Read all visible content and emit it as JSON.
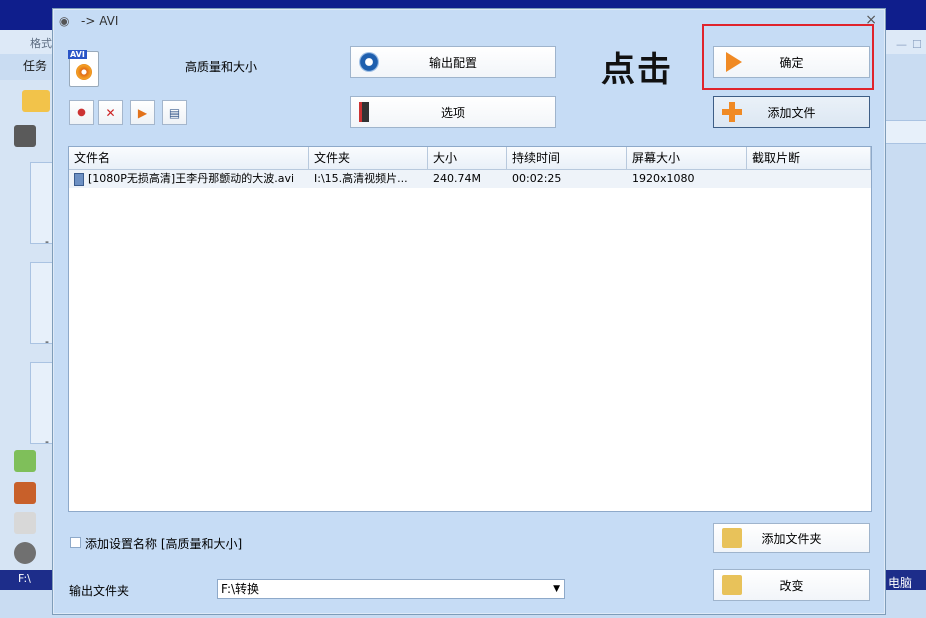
{
  "background": {
    "title": "格式",
    "tasks_label": "任务",
    "drive_label": "F:\\",
    "pc_label": "电脑",
    "dash": "-"
  },
  "dialog": {
    "title": "-> AVI",
    "close": "×",
    "profile_label": "高质量和大小",
    "profile_icon_tag": "AVI",
    "output_config_button": "输出配置",
    "options_button": "选项",
    "ok_button": "确定",
    "add_file_button": "添加文件",
    "add_folder_button": "添加文件夹",
    "change_button": "改变",
    "callout": "点击"
  },
  "list": {
    "headers": [
      "文件名",
      "文件夹",
      "大小",
      "持续时间",
      "屏幕大小",
      "截取片断"
    ],
    "rows": [
      [
        "[1080P无损高清]王李丹那颤动的大波.avi",
        "I:\\15.高清视频片...",
        "240.74M",
        "00:02:25",
        "1920x1080",
        ""
      ]
    ]
  },
  "footer": {
    "add_setting_name_label": "添加设置名称 [高质量和大小]",
    "output_folder_label": "输出文件夹",
    "output_folder_value": "F:\\转换"
  },
  "colors": {
    "accent_red": "#e0242c",
    "dialog_bg": "#c6dcf5",
    "desktop_bg": "#0f1e8c"
  }
}
